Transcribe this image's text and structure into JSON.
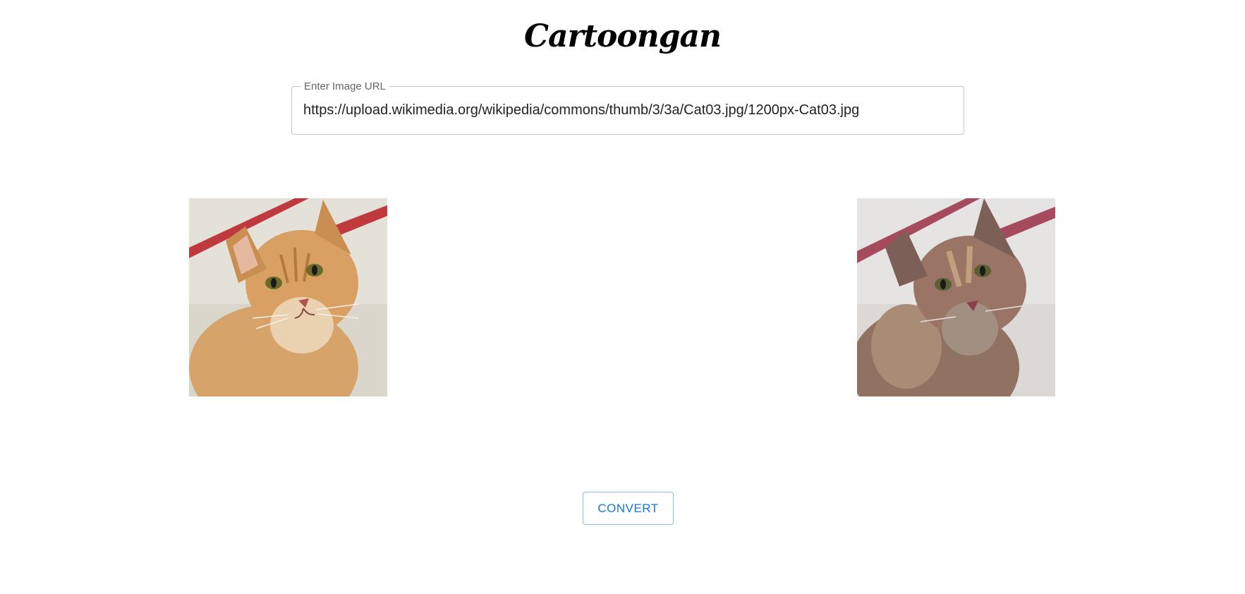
{
  "app": {
    "title": "Cartoongan"
  },
  "url_input": {
    "label": "Enter Image URL",
    "value": "https://upload.wikimedia.org/wikipedia/commons/thumb/3/3a/Cat03.jpg/1200px-Cat03.jpg"
  },
  "images": {
    "original": {
      "icon": "cat-photo-icon"
    },
    "cartoon": {
      "icon": "cartoonized-cat-photo-icon"
    }
  },
  "actions": {
    "convert_label": "CONVERT"
  },
  "colors": {
    "accent": "#1976d2",
    "border": "#c4c4c4"
  }
}
